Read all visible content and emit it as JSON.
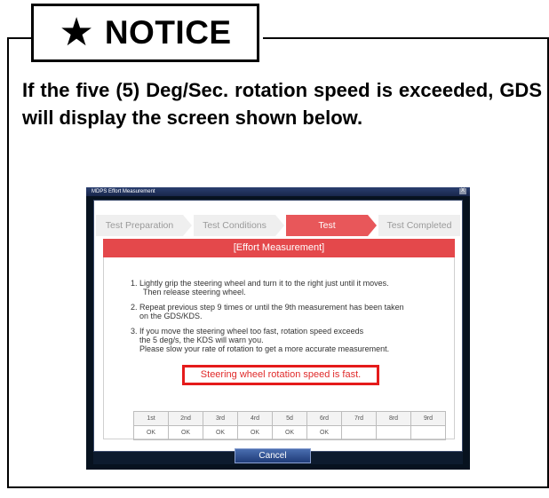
{
  "notice": {
    "star": "★",
    "title": "NOTICE",
    "text": "If the five (5) Deg/Sec. rotation speed is exceeded, GDS will display the screen shown below."
  },
  "window": {
    "title": "MDPS Effort Measurement",
    "close": "X",
    "steps": [
      "Test Preparation",
      "Test Conditions",
      "Test",
      "Test Completed"
    ],
    "active_step": "Test",
    "header": "[Effort Measurement]",
    "instructions": [
      "1. Lightly grip the steering wheel and turn it to the right just until it moves.",
      "Then release steering wheel.",
      "2. Repeat previous step 9 times or until the 9th measurement has been taken",
      "on the GDS/KDS.",
      "3. If you move the steering wheel too fast, rotation speed exceeds",
      "the 5 deg/s, the KDS will warn you.",
      "Please slow your rate of rotation to get a more  accurate measurement."
    ],
    "warning": "Steering wheel rotation speed is fast.",
    "table": {
      "headers": [
        "1st",
        "2nd",
        "3rd",
        "4rd",
        "5d",
        "6rd",
        "7rd",
        "8rd",
        "9rd"
      ],
      "values": [
        "OK",
        "OK",
        "OK",
        "OK",
        "OK",
        "OK",
        "",
        "",
        ""
      ]
    },
    "cancel_label": "Cancel"
  }
}
